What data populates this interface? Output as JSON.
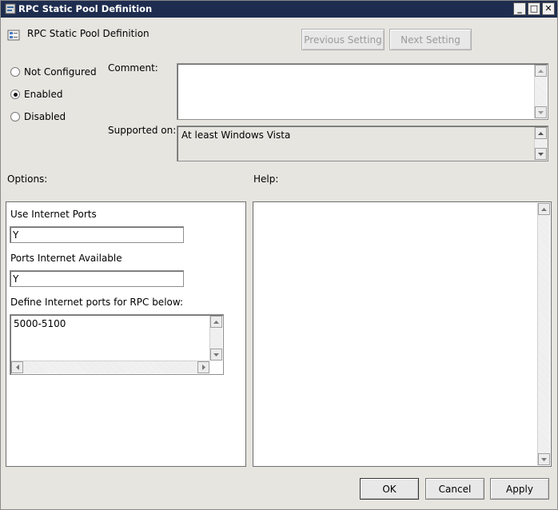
{
  "window": {
    "title": "RPC Static Pool Definition",
    "controls": [
      "minimize-icon",
      "maximize-icon",
      "close-icon"
    ]
  },
  "header": {
    "title": "RPC Static Pool Definition",
    "prev_button": "Previous Setting",
    "next_button": "Next Setting"
  },
  "state": {
    "options": [
      {
        "label": "Not Configured",
        "checked": false
      },
      {
        "label": "Enabled",
        "checked": true
      },
      {
        "label": "Disabled",
        "checked": false
      }
    ]
  },
  "comment": {
    "label": "Comment:",
    "value": ""
  },
  "supported": {
    "label": "Supported on:",
    "value": "At least Windows Vista"
  },
  "options_section": {
    "label": "Options:",
    "use_internet_ports": {
      "label": "Use Internet Ports",
      "value": "Y"
    },
    "ports_internet_available": {
      "label": "Ports Internet Available",
      "value": "Y"
    },
    "define_ports": {
      "label": "Define Internet ports for RPC below:",
      "value": "5000-5100"
    }
  },
  "help_section": {
    "label": "Help:",
    "text": ""
  },
  "footer": {
    "ok": "OK",
    "cancel": "Cancel",
    "apply": "Apply"
  }
}
